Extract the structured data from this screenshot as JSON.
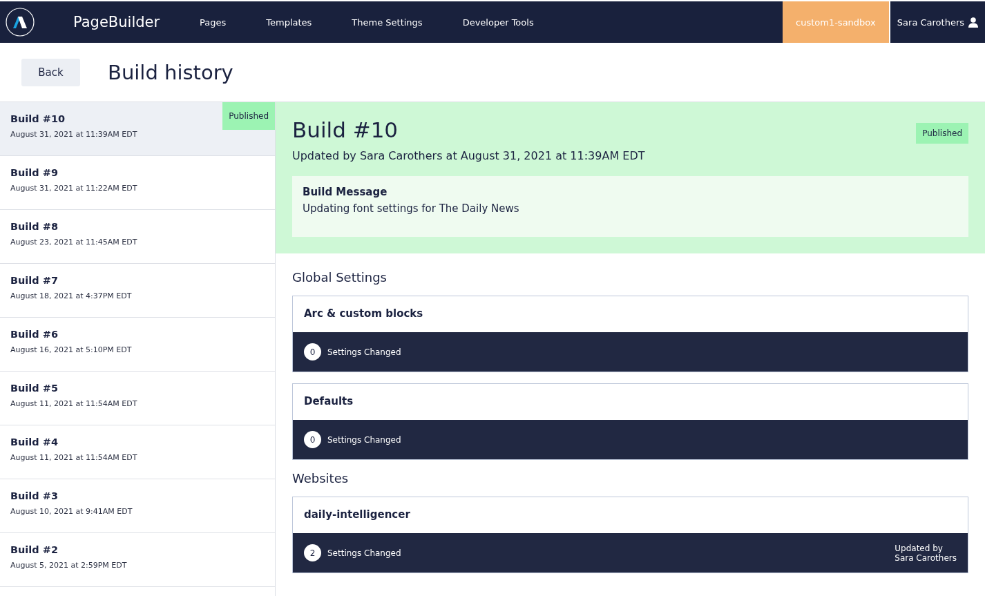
{
  "header": {
    "brand": "PageBuilder",
    "nav": [
      {
        "label": "Pages"
      },
      {
        "label": "Templates"
      },
      {
        "label": "Theme Settings"
      },
      {
        "label": "Developer Tools"
      }
    ],
    "environment": "custom1-sandbox",
    "user": "Sara Carothers"
  },
  "page": {
    "back": "Back",
    "title": "Build history"
  },
  "builds": [
    {
      "title": "Build #10",
      "date": "August 31, 2021 at 11:39AM EDT",
      "selected": true,
      "status": "Published"
    },
    {
      "title": "Build #9",
      "date": "August 31, 2021 at 11:22AM EDT",
      "selected": false
    },
    {
      "title": "Build #8",
      "date": "August 23, 2021 at 11:45AM EDT",
      "selected": false
    },
    {
      "title": "Build #7",
      "date": "August 18, 2021 at 4:37PM EDT",
      "selected": false
    },
    {
      "title": "Build #6",
      "date": "August 16, 2021 at 5:10PM EDT",
      "selected": false
    },
    {
      "title": "Build #5",
      "date": "August 11, 2021 at 11:54AM EDT",
      "selected": false
    },
    {
      "title": "Build #4",
      "date": "August 11, 2021 at 11:54AM EDT",
      "selected": false
    },
    {
      "title": "Build #3",
      "date": "August 10, 2021 at 9:41AM EDT",
      "selected": false
    },
    {
      "title": "Build #2",
      "date": "August 5, 2021 at 2:59PM EDT",
      "selected": false
    }
  ],
  "detail": {
    "title": "Build #10",
    "status": "Published",
    "subtitle": "Updated by Sara Carothers at August 31, 2021 at 11:39AM EDT",
    "message_label": "Build Message",
    "message": "Updating font settings for The Daily News",
    "sections": [
      {
        "heading": "Global Settings",
        "cards": [
          {
            "title": "Arc & custom blocks",
            "count": "0",
            "label": "Settings Changed"
          },
          {
            "title": "Defaults",
            "count": "0",
            "label": "Settings Changed"
          }
        ]
      },
      {
        "heading": "Websites",
        "cards": [
          {
            "title": "daily-intelligencer",
            "count": "2",
            "label": "Settings Changed",
            "updated_by": "Updated by\nSara Carothers"
          }
        ]
      }
    ]
  }
}
